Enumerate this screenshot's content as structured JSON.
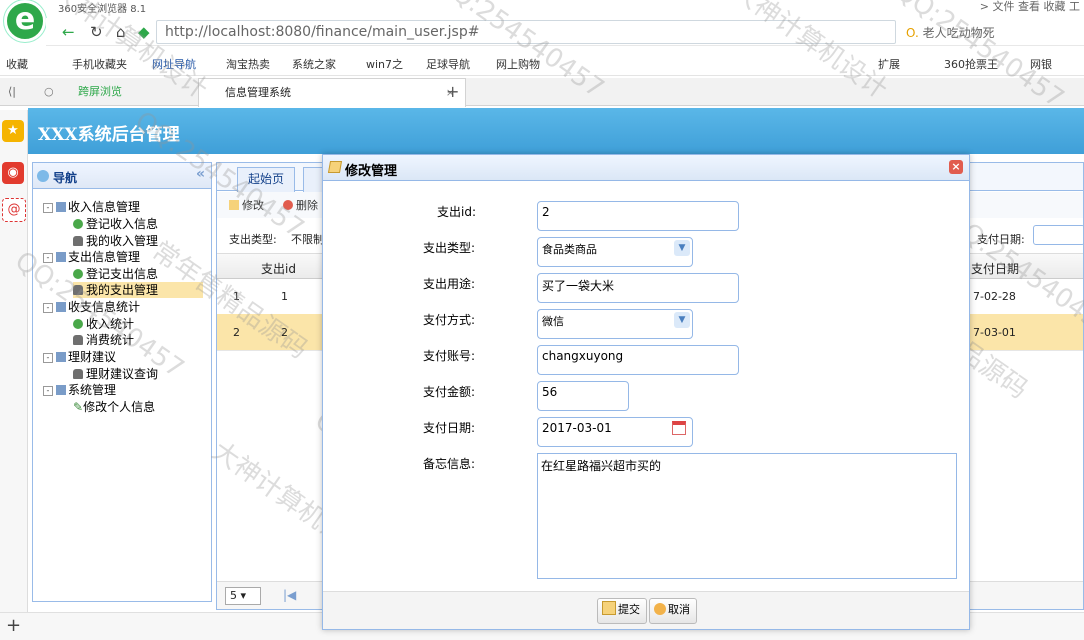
{
  "browser": {
    "name": "360安全浏览器 8.1",
    "top_menus": "> 文件  查看  收藏  工",
    "url_host": "http://localhost",
    "url_rest": ":8080/finance/main_user.jsp#",
    "search_hint": "老人吃动物死",
    "bookmarks": [
      "收藏",
      "手机收藏夹",
      "网址导航",
      "淘宝热卖",
      "系统之家",
      "win7之",
      "足球导航",
      "网上购物",
      "扩展",
      "360抢票王",
      "网银"
    ],
    "tabs": {
      "split_view": "跨屏浏览",
      "active": "信息管理系统",
      "close": "×",
      "new": "+"
    }
  },
  "app": {
    "title": "XXX系统后台管理"
  },
  "nav": {
    "title": "导航",
    "collapse": "«",
    "items": [
      {
        "label": "收入信息管理",
        "level": 0,
        "toggle": "-"
      },
      {
        "label": "登记收入信息",
        "level": 1,
        "icon": "add"
      },
      {
        "label": "我的收入管理",
        "level": 1,
        "icon": "user"
      },
      {
        "label": "支出信息管理",
        "level": 0,
        "toggle": "-"
      },
      {
        "label": "登记支出信息",
        "level": 1,
        "icon": "add"
      },
      {
        "label": "我的支出管理",
        "level": 1,
        "icon": "user"
      },
      {
        "label": "收支信息统计",
        "level": 0,
        "toggle": "-"
      },
      {
        "label": "收入统计",
        "level": 1,
        "icon": "add"
      },
      {
        "label": "消费统计",
        "level": 1,
        "icon": "user"
      },
      {
        "label": "理财建议",
        "level": 0,
        "toggle": "-"
      },
      {
        "label": "理财建议查询",
        "level": 1,
        "icon": "user"
      },
      {
        "label": "系统管理",
        "level": 0,
        "toggle": "-"
      },
      {
        "label": "修改个人信息",
        "level": 1,
        "icon": "pencil"
      }
    ]
  },
  "content": {
    "tabs": [
      "起始页"
    ],
    "toolbar": {
      "edit": "修改",
      "delete": "删除"
    },
    "filter": {
      "type_label": "支出类型:",
      "type_value": "不限制",
      "date_label": "支付日期:"
    },
    "grid": {
      "col_id": "支出id",
      "col_date": "支付日期",
      "rows": [
        {
          "num": "1",
          "id": "1",
          "date": "7-02-28"
        },
        {
          "num": "2",
          "id": "2",
          "date": "7-03-01"
        }
      ]
    },
    "pager": {
      "page_size": "5"
    }
  },
  "dialog": {
    "title": "修改管理",
    "close": "×",
    "fields": {
      "id": {
        "label": "支出id:",
        "value": "2"
      },
      "type": {
        "label": "支出类型:",
        "value": "食品类商品"
      },
      "purpose": {
        "label": "支出用途:",
        "value": "买了一袋大米"
      },
      "method": {
        "label": "支付方式:",
        "value": "微信"
      },
      "account": {
        "label": "支付账号:",
        "value": "changxuyong"
      },
      "amount": {
        "label": "支付金额:",
        "value": "56"
      },
      "date": {
        "label": "支付日期:",
        "value": "2017-03-01"
      },
      "memo": {
        "label": "备忘信息:",
        "value": "在红星路福兴超市买的"
      }
    },
    "buttons": {
      "submit": "提交",
      "cancel": "取消"
    }
  },
  "watermark": {
    "texts": [
      "大神计算机设计",
      "常年售精品源码",
      "QQ:254540457"
    ]
  }
}
